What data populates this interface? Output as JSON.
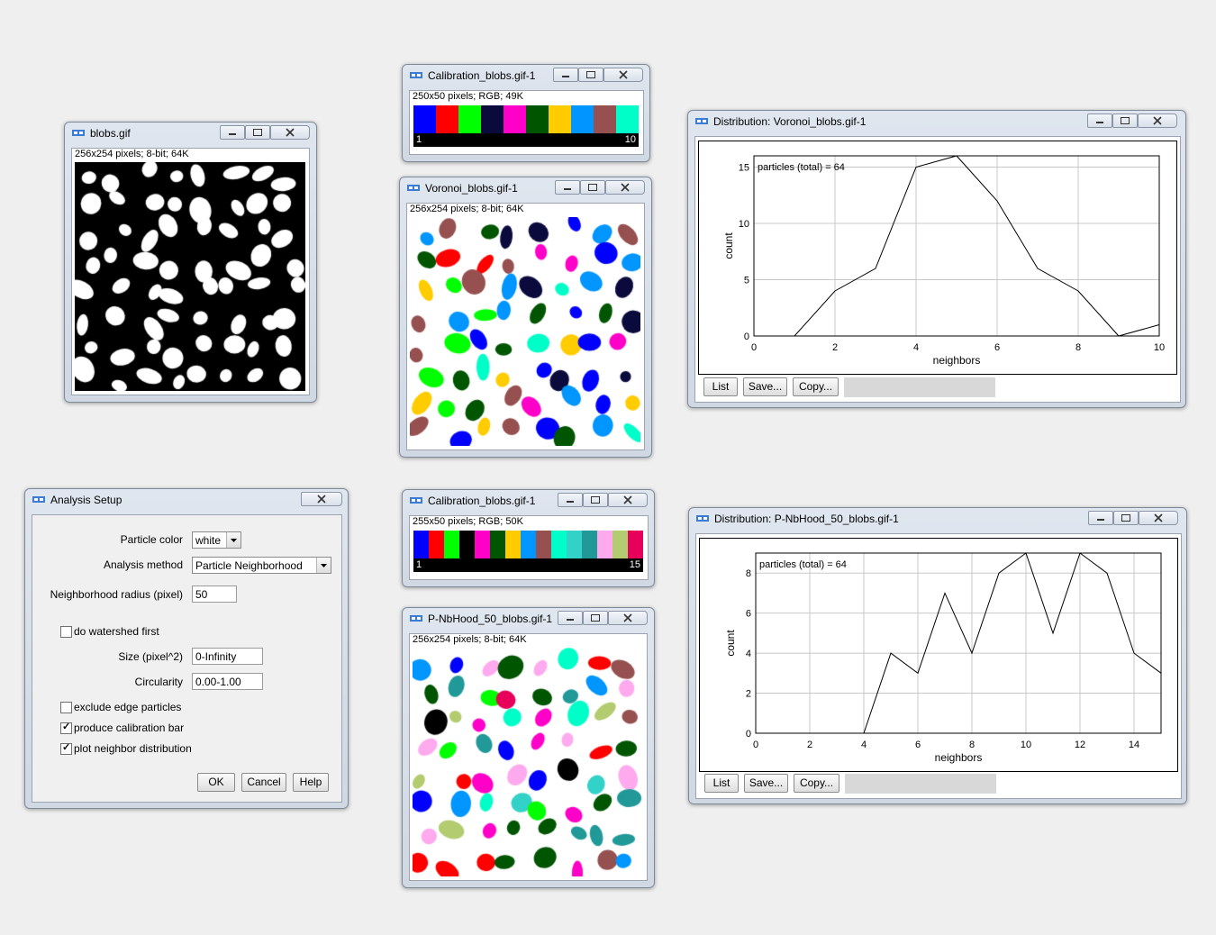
{
  "windows": {
    "blobs": {
      "title": "blobs.gif",
      "info": "256x254 pixels; 8-bit; 64K"
    },
    "cal1": {
      "title": "Calibration_blobs.gif-1",
      "info": "250x50 pixels; RGB; 49K",
      "colors": [
        "#0000ff",
        "#ff0000",
        "#00ff00",
        "#0a0a3c",
        "#ff00c8",
        "#005500",
        "#ffcc00",
        "#0095ff",
        "#965050",
        "#00ffc8"
      ],
      "min_label": "1",
      "max_label": "10"
    },
    "voronoi": {
      "title": "Voronoi_blobs.gif-1",
      "info": "256x254 pixels; 8-bit; 64K"
    },
    "cal2": {
      "title": "Calibration_blobs.gif-1",
      "info": "255x50 pixels; RGB; 50K",
      "colors": [
        "#0000ff",
        "#ff0000",
        "#00ff00",
        "#000000",
        "#ff00c8",
        "#005500",
        "#ffcc00",
        "#0095ff",
        "#965050",
        "#00ffc8",
        "#32d2c8",
        "#229999",
        "#ffaaee",
        "#b3cc70",
        "#e6005a"
      ],
      "min_label": "1",
      "max_label": "15"
    },
    "pnbhood": {
      "title": "P-NbHood_50_blobs.gif-1",
      "info": "256x254 pixels; 8-bit; 64K"
    },
    "dist1": {
      "title": "Distribution: Voronoi_blobs.gif-1"
    },
    "dist2": {
      "title": "Distribution: P-NbHood_50_blobs.gif-1"
    },
    "setup": {
      "title": "Analysis Setup"
    }
  },
  "plot_buttons": {
    "list": "List",
    "save": "Save...",
    "copy": "Copy..."
  },
  "setup": {
    "particle_color_label": "Particle color",
    "particle_color_value": "white",
    "analysis_method_label": "Analysis method",
    "analysis_method_value": "Particle Neighborhood",
    "radius_label": "Neighborhood radius (pixel)",
    "radius_value": "50",
    "watershed_label": "do watershed first",
    "watershed_checked": false,
    "size_label": "Size (pixel^2)",
    "size_value": "0-Infinity",
    "circularity_label": "Circularity",
    "circularity_value": "0.00-1.00",
    "exclude_label": "exclude edge particles",
    "exclude_checked": false,
    "calbar_label": "produce calibration bar",
    "calbar_checked": true,
    "plot_label": "plot neighbor distribution",
    "plot_checked": true,
    "ok": "OK",
    "cancel": "Cancel",
    "help": "Help"
  },
  "chart_data": [
    {
      "type": "line",
      "annotation": "particles (total) = 64",
      "xlabel": "neighbors",
      "ylabel": "count",
      "x": [
        0,
        1,
        2,
        3,
        4,
        5,
        6,
        7,
        8,
        9,
        10
      ],
      "values": [
        0,
        0,
        4,
        6,
        15,
        16,
        12,
        6,
        4,
        0,
        1
      ],
      "xlim": [
        0,
        10
      ],
      "ylim": [
        0,
        16
      ],
      "xticks": [
        "0",
        "2",
        "4",
        "6",
        "8",
        "10"
      ],
      "yticks": [
        "0",
        "5",
        "10",
        "15"
      ],
      "grid": true
    },
    {
      "type": "line",
      "annotation": "particles (total) = 64",
      "xlabel": "neighbors",
      "ylabel": "count",
      "x": [
        0,
        1,
        2,
        3,
        4,
        5,
        6,
        7,
        8,
        9,
        10,
        11,
        12,
        13,
        14,
        15
      ],
      "values": [
        0,
        0,
        0,
        0,
        0,
        4,
        3,
        7,
        4,
        8,
        9,
        5,
        9,
        8,
        4,
        3
      ],
      "xlim": [
        0,
        15
      ],
      "ylim": [
        0,
        9
      ],
      "xticks": [
        "0",
        "2",
        "4",
        "6",
        "8",
        "10",
        "12",
        "14"
      ],
      "yticks": [
        "0",
        "2",
        "4",
        "6",
        "8"
      ],
      "grid": true
    }
  ]
}
